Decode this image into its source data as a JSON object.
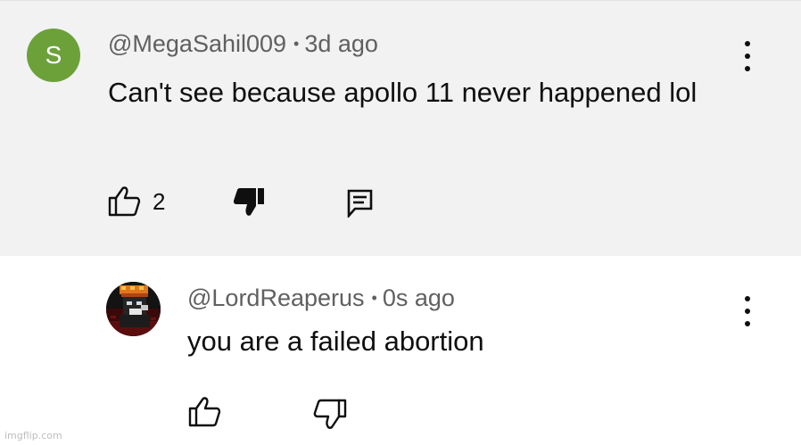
{
  "comment": {
    "avatar_initial": "S",
    "avatar_color": "#6ca13a",
    "author": "@MegaSahil009",
    "separator": "•",
    "time": "3d ago",
    "text": "Can't see because apollo 11 never happened lol",
    "like_count": "2",
    "like_icon": "thumbs-up-outline-icon",
    "dislike_icon": "thumbs-down-filled-icon",
    "reply_icon": "comment-reply-icon",
    "menu_icon": "vertical-ellipsis-icon",
    "background": "#f2f2f2"
  },
  "reply": {
    "author": "@LordReaperus",
    "separator": "•",
    "time": "0s ago",
    "text": "you are a failed abortion",
    "like_icon": "thumbs-up-outline-icon",
    "dislike_icon": "thumbs-down-outline-icon",
    "menu_icon": "vertical-ellipsis-icon"
  },
  "watermark": "imgflip.com"
}
